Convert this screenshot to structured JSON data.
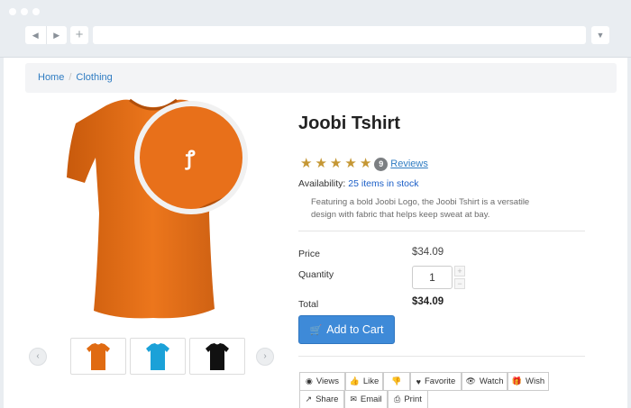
{
  "browser": {
    "back_icon": "◀",
    "forward_icon": "▶",
    "new_tab_icon": "+",
    "menu_icon": "▼"
  },
  "breadcrumb": {
    "items": [
      "Home",
      "Clothing"
    ],
    "separator": "/"
  },
  "product": {
    "title": "Joobi Tshirt",
    "rating": 5,
    "stars": [
      "★",
      "★",
      "★",
      "★",
      "★"
    ],
    "review_count": "9",
    "reviews_label": "Reviews",
    "availability_label": "Availability:",
    "availability_value": "25 items in stock",
    "description": "Featuring a bold Joobi Logo, the Joobi Tshirt is a versatile design with fabric that helps keep sweat at bay.",
    "price_label": "Price",
    "price_value": "$34.09",
    "quantity_label": "Quantity",
    "quantity_value": "1",
    "step_up": "+",
    "step_down": "−",
    "total_label": "Total",
    "total_value": "$34.09",
    "add_to_cart": "Add to Cart",
    "cart_icon": "🛒"
  },
  "gallery": {
    "prev_icon": "‹",
    "next_icon": "›",
    "thumbnails": [
      {
        "color": "#e06b12"
      },
      {
        "color": "#1ba1d8"
      },
      {
        "color": "#111111"
      }
    ],
    "main_color": "#e8701a"
  },
  "actions": {
    "row1": [
      {
        "label": "Views",
        "icon": "◉"
      },
      {
        "label": "Like",
        "icon": "👍"
      },
      {
        "label": "",
        "icon": "👎"
      },
      {
        "label": "Favorite",
        "icon": "♥"
      },
      {
        "label": "Watch",
        "icon": "👁"
      },
      {
        "label": "Wish",
        "icon": "🎁"
      }
    ],
    "row2": [
      {
        "label": "Share",
        "icon": "↗"
      },
      {
        "label": "Email",
        "icon": "✉"
      },
      {
        "label": "Print",
        "icon": "⎙"
      }
    ]
  }
}
